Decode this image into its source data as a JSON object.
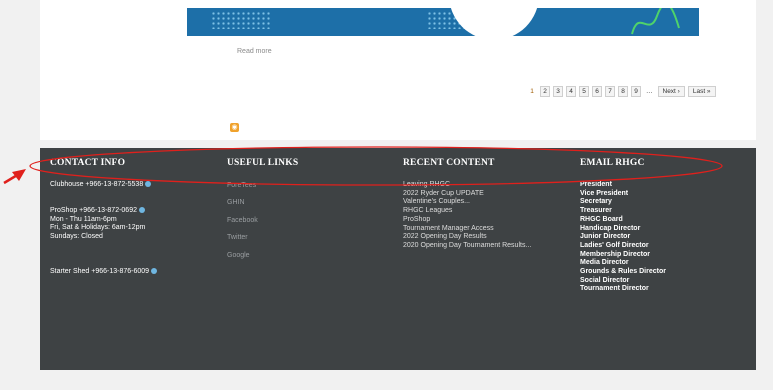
{
  "content": {
    "read_more": "Read more"
  },
  "pager": {
    "items": [
      {
        "label": "1",
        "current": true
      },
      {
        "label": "2"
      },
      {
        "label": "3"
      },
      {
        "label": "4"
      },
      {
        "label": "5"
      },
      {
        "label": "6"
      },
      {
        "label": "7"
      },
      {
        "label": "8"
      },
      {
        "label": "9"
      },
      {
        "label": "…",
        "ellipsis": true
      },
      {
        "label": "Next ›",
        "wide": true
      },
      {
        "label": "Last »",
        "wide": true
      }
    ]
  },
  "footer": {
    "contact": {
      "title": "CONTACT INFO",
      "clubhouse": "Clubhouse  +966-13-872-5538",
      "proshop": "ProShop    +966-13-872-0692",
      "hours1": "Mon - Thu 11am-6pm",
      "hours2": "Fri, Sat & Holidays: 6am-12pm",
      "hours3": "Sundays: Closed",
      "starter": "Starter Shed +966-13-876-6009"
    },
    "useful": {
      "title": "USEFUL LINKS",
      "links": [
        "ForeTees",
        "GHIN",
        "Facebook",
        "Twitter",
        "Google"
      ]
    },
    "recent": {
      "title": "RECENT CONTENT",
      "items": [
        "Leaving RHGC",
        "2022 Ryder Cup UPDATE",
        "Valentine's Couples...",
        "RHGC Leagues",
        "ProShop",
        "Tournament Manager Access",
        "2022 Opening Day Results",
        "2020 Opening Day Tournament Results..."
      ]
    },
    "email": {
      "title": "EMAIL RHGC",
      "items": [
        "President",
        "Vice President",
        "Secretary",
        "Treasurer",
        "RHGC Board",
        "Handicap Director",
        "Junior Director",
        "Ladies' Golf Director",
        "Membership Director",
        "Media Director",
        "Grounds & Rules Director",
        "Social Director",
        "Tournament Director"
      ]
    }
  },
  "colors": {
    "footer_bg": "#3e4244",
    "annotation": "#e0201c",
    "banner": "#1d6fa8"
  }
}
